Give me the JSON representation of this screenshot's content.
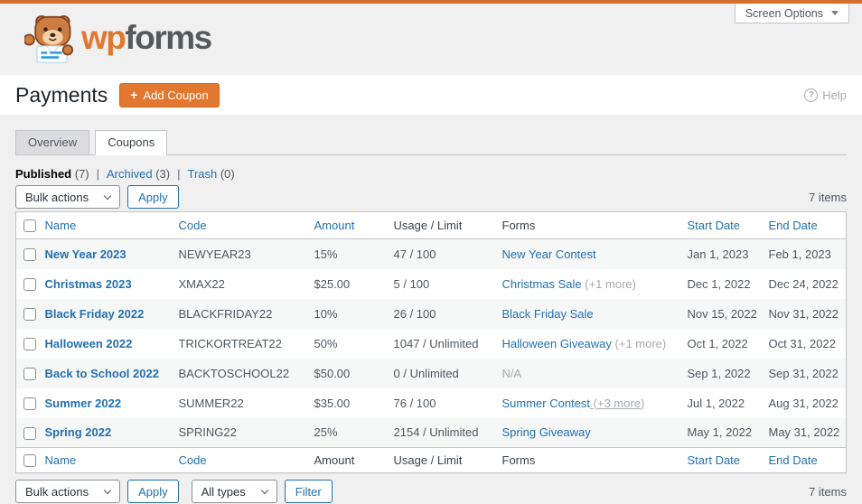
{
  "screen_options": {
    "label": "Screen Options"
  },
  "logo": {
    "wp": "wp",
    "forms": "forms"
  },
  "title_bar": {
    "title": "Payments",
    "add_coupon_plus": "+",
    "add_coupon": "Add Coupon",
    "help": "Help",
    "help_icon": "?"
  },
  "tabs": [
    {
      "label": "Overview",
      "active": false
    },
    {
      "label": "Coupons",
      "active": true
    }
  ],
  "status_filters": [
    {
      "label": "Published",
      "count": "(7)",
      "active": true
    },
    {
      "label": "Archived",
      "count": "(3)",
      "active": false
    },
    {
      "label": "Trash",
      "count": "(0)",
      "active": false
    }
  ],
  "toolbar": {
    "bulk_actions": "Bulk actions",
    "apply": "Apply",
    "items_count": "7 items"
  },
  "bottom_toolbar": {
    "bulk_actions": "Bulk actions",
    "apply": "Apply",
    "type_filter": "All types",
    "filter": "Filter",
    "items_count": "7 items"
  },
  "table": {
    "columns": [
      {
        "label": "Name",
        "header_link": true,
        "footer_link": true
      },
      {
        "label": "Code",
        "header_link": true,
        "footer_link": true
      },
      {
        "label": "Amount",
        "header_link": true,
        "footer_link": false
      },
      {
        "label": "Usage / Limit",
        "header_link": false,
        "footer_link": false
      },
      {
        "label": "Forms",
        "header_link": false,
        "footer_link": false
      },
      {
        "label": "Start Date",
        "header_link": true,
        "footer_link": true
      },
      {
        "label": "End Date",
        "header_link": true,
        "footer_link": true
      }
    ],
    "rows": [
      {
        "name": "New Year 2023",
        "code": "NEWYEAR23",
        "amount": "15%",
        "usage": "47 / 100",
        "form": "New Year Contest",
        "form_more": "",
        "form_more_underline": false,
        "form_na": "",
        "start": "Jan 1, 2023",
        "end": "Feb 1, 2023"
      },
      {
        "name": "Christmas 2023",
        "code": "XMAX22",
        "amount": "$25.00",
        "usage": "5 / 100",
        "form": "Christmas Sale",
        "form_more": "(+1 more)",
        "form_more_underline": false,
        "form_na": "",
        "start": "Dec 1, 2022",
        "end": "Dec 24, 2022"
      },
      {
        "name": "Black Friday 2022",
        "code": "BLACKFRIDAY22",
        "amount": "10%",
        "usage": "26 / 100",
        "form": "Black Friday Sale",
        "form_more": "",
        "form_more_underline": false,
        "form_na": "",
        "start": "Nov 15, 2022",
        "end": "Nov 31, 2022"
      },
      {
        "name": "Halloween 2022",
        "code": "TRICKORTREAT22",
        "amount": "50%",
        "usage": "1047 / Unlimited",
        "form": "Halloween Giveaway",
        "form_more": "(+1 more)",
        "form_more_underline": false,
        "form_na": "",
        "start": "Oct 1, 2022",
        "end": "Oct 31, 2022"
      },
      {
        "name": "Back to School 2022",
        "code": "BACKTOSCHOOL22",
        "amount": "$50.00",
        "usage": "0 / Unlimited",
        "form": "",
        "form_more": "",
        "form_more_underline": false,
        "form_na": "N/A",
        "start": "Sep 1, 2022",
        "end": "Sep 31, 2022"
      },
      {
        "name": "Summer 2022",
        "code": "SUMMER22",
        "amount": "$35.00",
        "usage": "76 / 100",
        "form": "Summer Contest",
        "form_more": "(+3 more)",
        "form_more_underline": true,
        "form_na": "",
        "start": "Jul 1, 2022",
        "end": "Aug 31, 2022"
      },
      {
        "name": "Spring 2022",
        "code": "SPRING22",
        "amount": "25%",
        "usage": "2154 / Unlimited",
        "form": "Spring Giveaway",
        "form_more": "",
        "form_more_underline": false,
        "form_na": "",
        "start": "May 1, 2022",
        "end": "May 31, 2022"
      }
    ]
  },
  "colors": {
    "brand_orange": "#e27730",
    "link_blue": "#2271b1",
    "muted_gray": "#a7aaad",
    "page_bg": "#f0f0f1"
  }
}
